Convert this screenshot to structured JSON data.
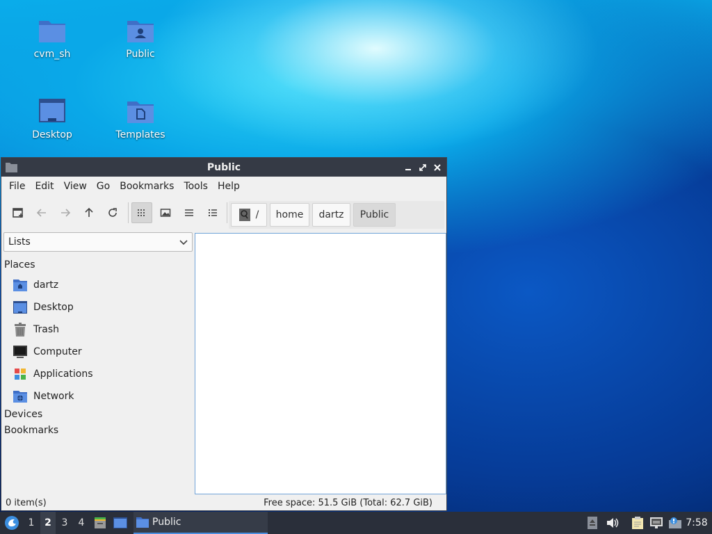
{
  "desktop": {
    "icons": [
      {
        "label": "cvm_sh"
      },
      {
        "label": "Public"
      },
      {
        "label": "Desktop"
      },
      {
        "label": "Templates"
      }
    ]
  },
  "window": {
    "title": "Public",
    "menu": [
      "File",
      "Edit",
      "View",
      "Go",
      "Bookmarks",
      "Tools",
      "Help"
    ],
    "toolbar": {
      "buttons": [
        "new-tab-icon",
        "back-icon",
        "forward-icon",
        "up-icon",
        "reload-icon",
        "icon-view-icon",
        "thumbnail-view-icon",
        "compact-view-icon",
        "detailed-list-icon"
      ],
      "active_view": "icon-view-icon"
    },
    "path": [
      "/",
      "home",
      "dartz",
      "Public"
    ],
    "sidebar": {
      "mode": "Lists",
      "places_header": "Places",
      "places": [
        {
          "label": "dartz",
          "icon": "home-folder-icon"
        },
        {
          "label": "Desktop",
          "icon": "desktop-icon"
        },
        {
          "label": "Trash",
          "icon": "trash-icon"
        },
        {
          "label": "Computer",
          "icon": "computer-icon"
        },
        {
          "label": "Applications",
          "icon": "applications-icon"
        },
        {
          "label": "Network",
          "icon": "network-icon"
        }
      ],
      "devices_header": "Devices",
      "bookmarks_header": "Bookmarks"
    },
    "status": {
      "items": "0 item(s)",
      "free_space": "Free space: 51.5 GiB (Total: 62.7 GiB)"
    }
  },
  "taskbar": {
    "workspaces": [
      "1",
      "2",
      "3",
      "4"
    ],
    "active_workspace": "2",
    "task_label": "Public",
    "clock": "7:58"
  },
  "colors": {
    "titlebar": "#353a45",
    "taskbar": "#2a2f3a",
    "folder": "#4a7fd4",
    "accent": "#4c8fe0"
  }
}
